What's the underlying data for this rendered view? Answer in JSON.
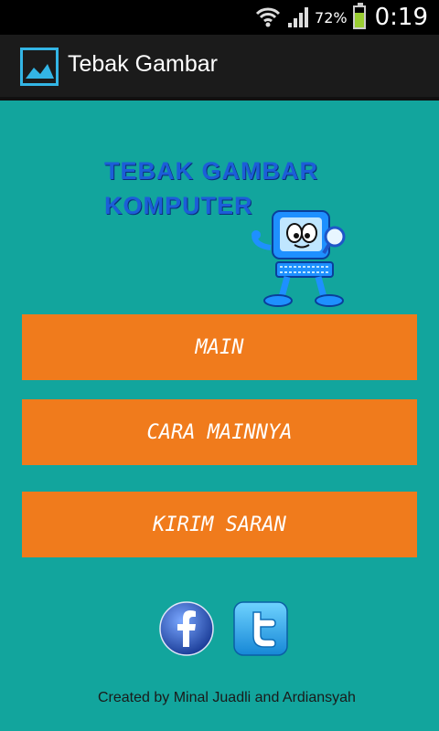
{
  "status_bar": {
    "battery_percent": "72%",
    "battery_level": 0.72,
    "time": "0:19",
    "icons": [
      "wifi-icon",
      "signal-icon",
      "battery-icon"
    ]
  },
  "action_bar": {
    "title": "Tebak Gambar",
    "icon": "image-icon"
  },
  "logo": {
    "line1": "TEBAK GAMBAR",
    "line2": "KOMPUTER",
    "mascot": "computer-mascot-icon"
  },
  "menu": {
    "items": [
      {
        "label": "MAIN"
      },
      {
        "label": "CARA MAINNYA"
      },
      {
        "label": "KIRIM SARAN"
      }
    ]
  },
  "social": {
    "facebook_icon": "facebook-icon",
    "twitter_icon": "twitter-icon"
  },
  "footer": {
    "credit": "Created by Minal Juadli and Ardiansyah"
  },
  "colors": {
    "background": "#12a59d",
    "button": "#f07b1c",
    "action_bar": "#1b1b1b"
  }
}
